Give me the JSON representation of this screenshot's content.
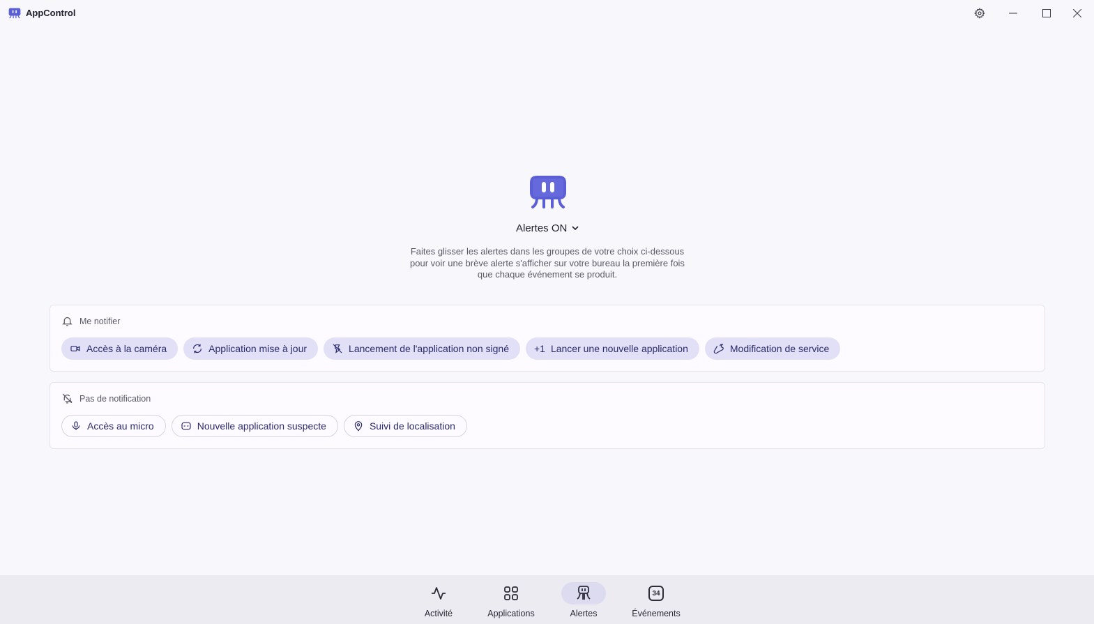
{
  "app": {
    "title": "AppControl"
  },
  "colors": {
    "accent": "#5b5fd6",
    "chip_fill": "#e1e0f6",
    "chip_text": "#2a2a6e",
    "background": "#f8f7fb"
  },
  "hero": {
    "status_label": "Alertes ON",
    "description": "Faites glisser les alertes dans les groupes de votre choix ci-dessous pour voir une brève alerte s'afficher sur votre bureau la première fois que chaque événement se produit."
  },
  "groups": {
    "notify": {
      "title": "Me notifier",
      "icon": "bell-icon",
      "chips": [
        {
          "label": "Accès à la caméra",
          "icon": "camera-icon"
        },
        {
          "label": "Application mise à jour",
          "icon": "refresh-icon"
        },
        {
          "label": "Lancement de l'application non signé",
          "icon": "unsigned-icon"
        },
        {
          "label": "Lancer une nouvelle application",
          "prefix": "+1"
        },
        {
          "label": "Modification de service",
          "icon": "wrench-icon"
        }
      ]
    },
    "silent": {
      "title": "Pas de notification",
      "icon": "bell-off-icon",
      "chips": [
        {
          "label": "Accès au micro",
          "icon": "microphone-icon"
        },
        {
          "label": "Nouvelle application suspecte",
          "icon": "mask-icon"
        },
        {
          "label": "Suivi de localisation",
          "icon": "location-pin-icon"
        }
      ]
    }
  },
  "nav": {
    "items": [
      {
        "label": "Activité",
        "icon": "activity-icon",
        "active": false
      },
      {
        "label": "Applications",
        "icon": "grid-icon",
        "active": false
      },
      {
        "label": "Alertes",
        "icon": "alerts-icon",
        "active": true
      },
      {
        "label": "Événements",
        "icon": "events-badge-icon",
        "active": false,
        "badge": "34"
      }
    ]
  }
}
